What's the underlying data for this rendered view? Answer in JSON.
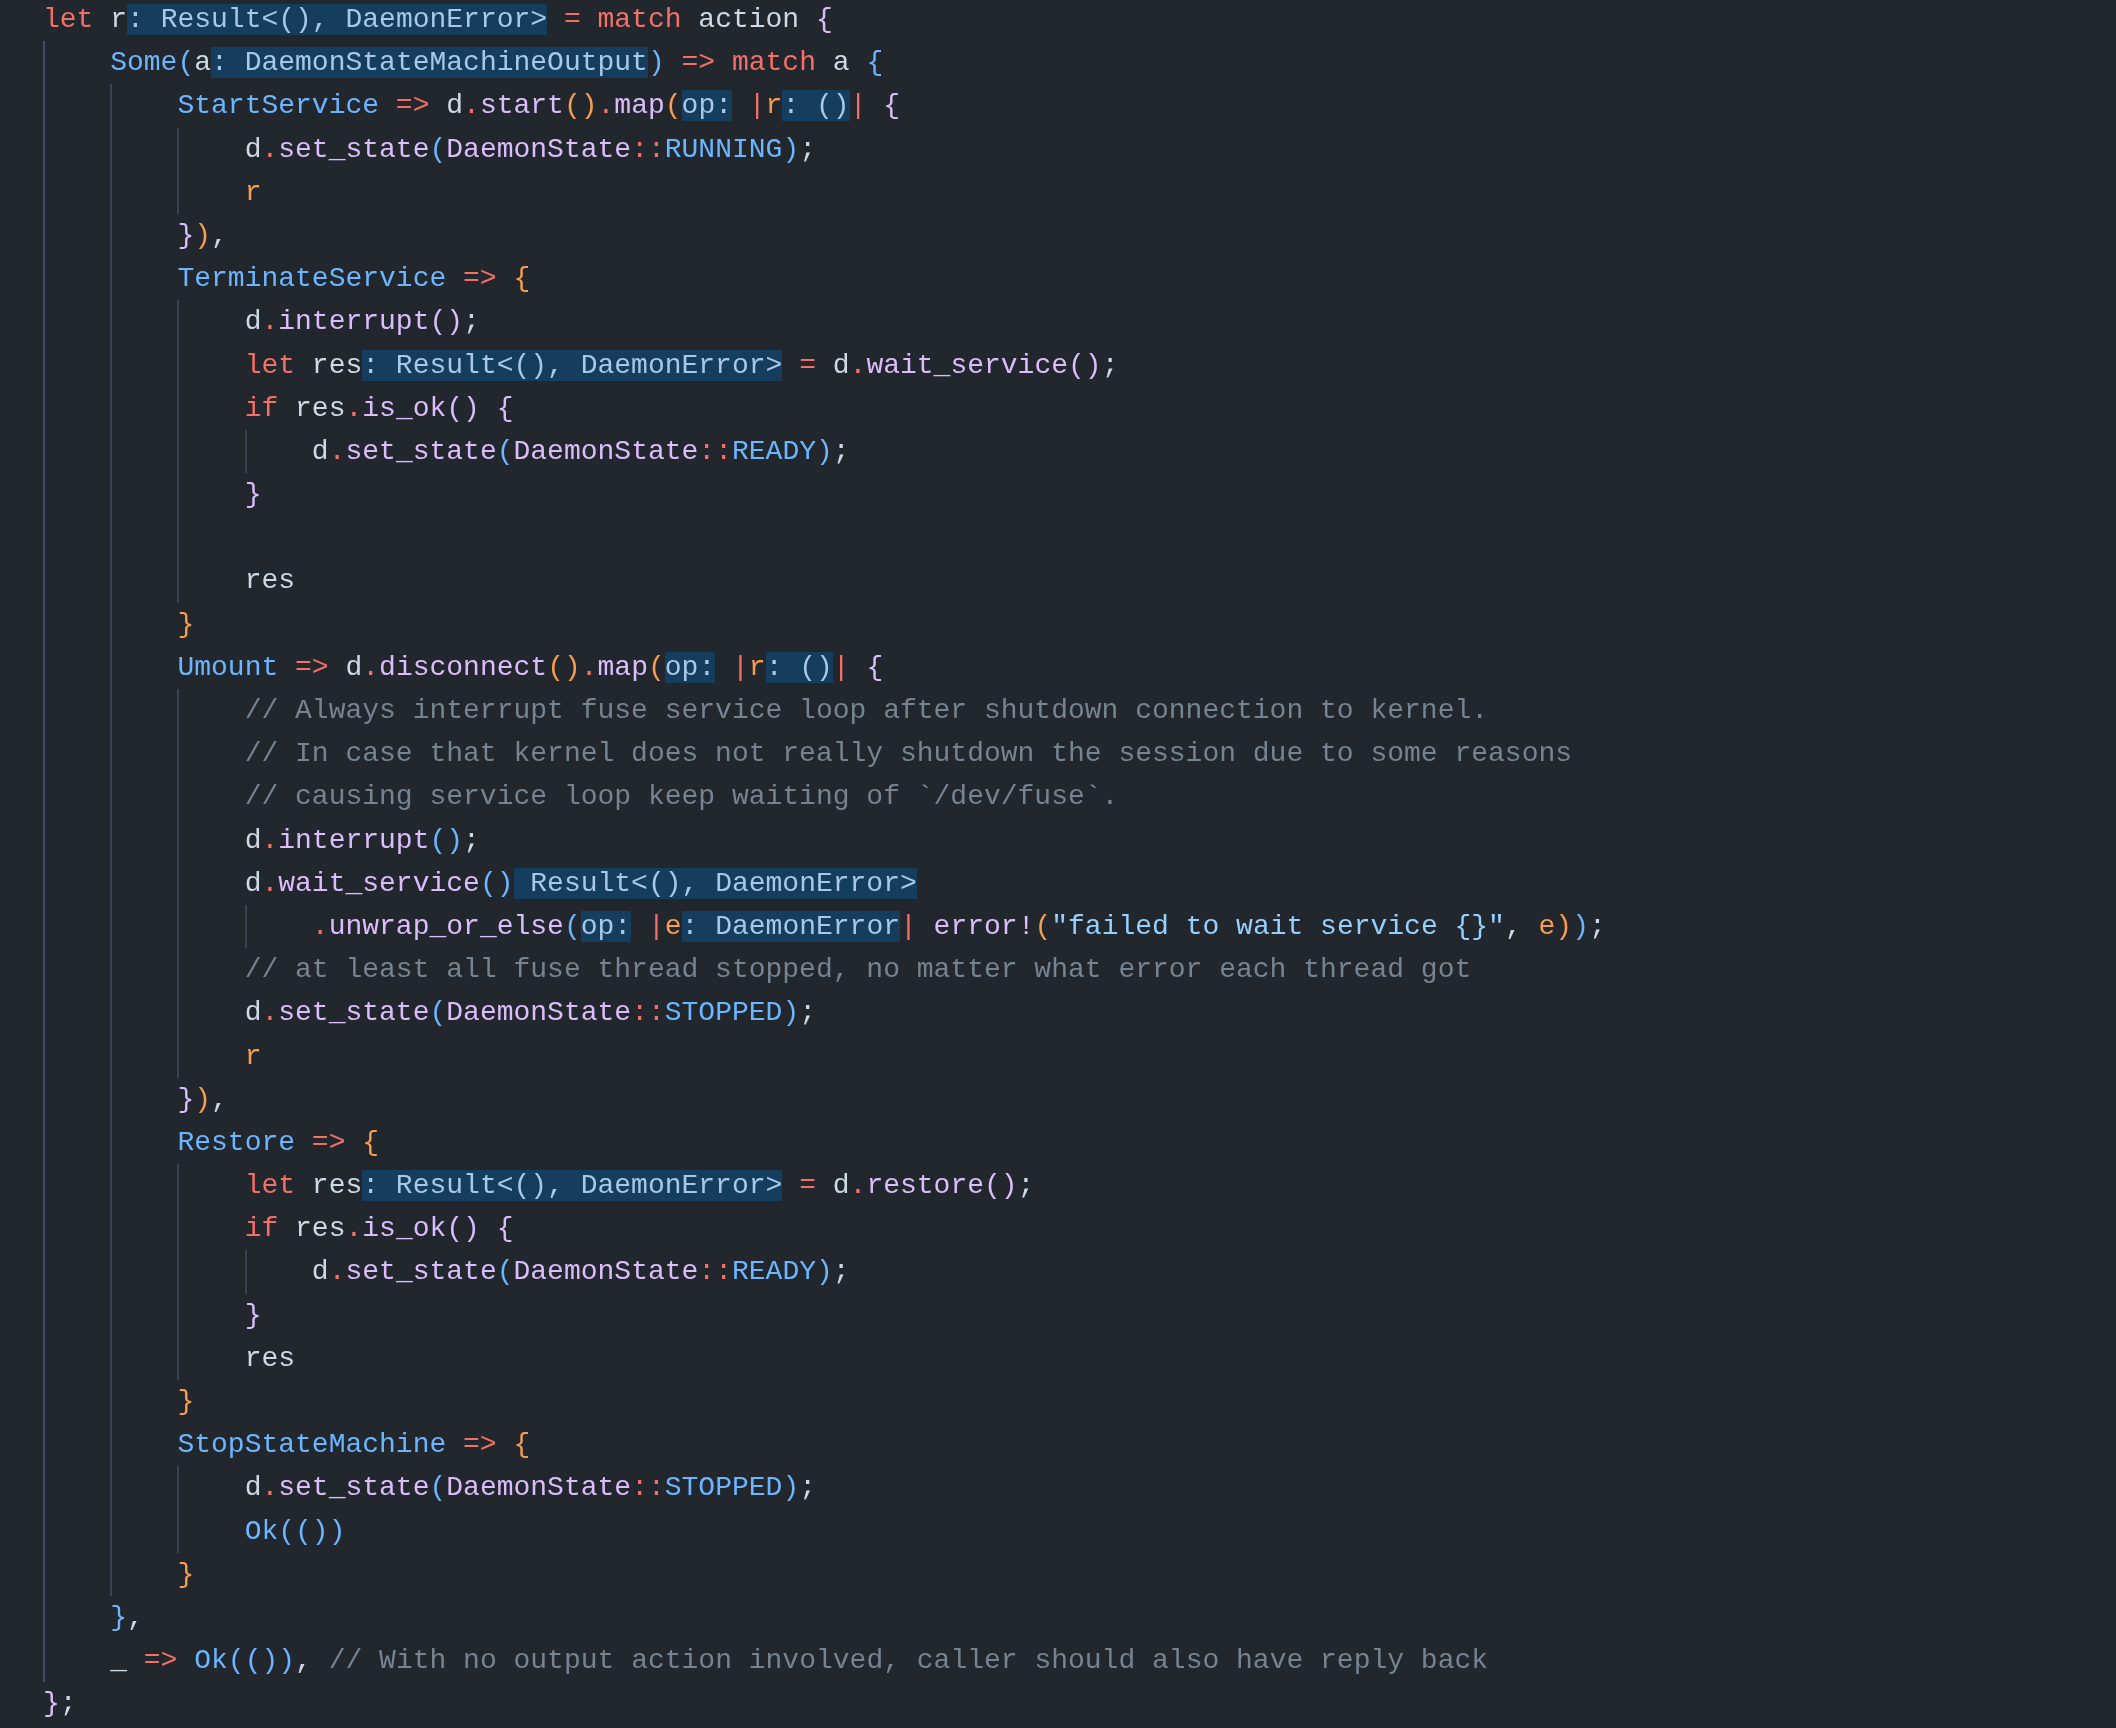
{
  "editor": {
    "lines": [
      {
        "kind": "code",
        "tokens": [
          {
            "kind": "kw",
            "text": "let"
          },
          {
            "kind": "plain",
            "text": " r"
          },
          {
            "kind": "hint",
            "text": ": Result<(), DaemonError>"
          },
          {
            "kind": "kw",
            "text": " = match"
          },
          {
            "kind": "plain",
            "text": " action "
          },
          {
            "kind": "purple",
            "text": "{"
          }
        ]
      },
      {
        "kind": "code",
        "tokens": [
          {
            "kind": "type",
            "text": "    Some"
          },
          {
            "kind": "blue",
            "text": "("
          },
          {
            "kind": "plain",
            "text": "a"
          },
          {
            "kind": "hint",
            "text": ": DaemonStateMachineOutput"
          },
          {
            "kind": "blue",
            "text": ")"
          },
          {
            "kind": "kw",
            "text": " => match"
          },
          {
            "kind": "plain",
            "text": " a "
          },
          {
            "kind": "blue",
            "text": "{"
          }
        ]
      },
      {
        "kind": "code",
        "tokens": [
          {
            "kind": "type",
            "text": "        StartService"
          },
          {
            "kind": "kw",
            "text": " =>"
          },
          {
            "kind": "plain",
            "text": " d"
          },
          {
            "kind": "kw",
            "text": "."
          },
          {
            "kind": "fn",
            "text": "start"
          },
          {
            "kind": "orange",
            "text": "()"
          },
          {
            "kind": "kw",
            "text": "."
          },
          {
            "kind": "fn",
            "text": "map"
          },
          {
            "kind": "orange",
            "text": "("
          },
          {
            "kind": "hint",
            "text": "op:"
          },
          {
            "kind": "kw",
            "text": " |"
          },
          {
            "kind": "var",
            "text": "r"
          },
          {
            "kind": "hint",
            "text": ": ()"
          },
          {
            "kind": "kw",
            "text": "|"
          },
          {
            "kind": "purple",
            "text": " {"
          }
        ]
      },
      {
        "kind": "code",
        "tokens": [
          {
            "kind": "plain",
            "text": "            d"
          },
          {
            "kind": "kw",
            "text": "."
          },
          {
            "kind": "fn",
            "text": "set_state"
          },
          {
            "kind": "blue",
            "text": "("
          },
          {
            "kind": "fn",
            "text": "DaemonState"
          },
          {
            "kind": "kw",
            "text": "::"
          },
          {
            "kind": "type",
            "text": "RUNNING"
          },
          {
            "kind": "blue",
            "text": ")"
          },
          {
            "kind": "plain",
            "text": ";"
          }
        ]
      },
      {
        "kind": "code",
        "tokens": [
          {
            "kind": "var",
            "text": "            r"
          }
        ]
      },
      {
        "kind": "code",
        "tokens": [
          {
            "kind": "purple",
            "text": "        }"
          },
          {
            "kind": "orange",
            "text": ")"
          },
          {
            "kind": "plain",
            "text": ","
          }
        ]
      },
      {
        "kind": "code",
        "tokens": [
          {
            "kind": "type",
            "text": "        TerminateService"
          },
          {
            "kind": "kw",
            "text": " =>"
          },
          {
            "kind": "orange",
            "text": " {"
          }
        ]
      },
      {
        "kind": "code",
        "tokens": [
          {
            "kind": "plain",
            "text": "            d"
          },
          {
            "kind": "kw",
            "text": "."
          },
          {
            "kind": "fn",
            "text": "interrupt"
          },
          {
            "kind": "purple",
            "text": "()"
          },
          {
            "kind": "plain",
            "text": ";"
          }
        ]
      },
      {
        "kind": "code",
        "tokens": [
          {
            "kind": "kw",
            "text": "            let"
          },
          {
            "kind": "plain",
            "text": " res"
          },
          {
            "kind": "hint",
            "text": ": Result<(), DaemonError>"
          },
          {
            "kind": "kw",
            "text": " ="
          },
          {
            "kind": "plain",
            "text": " d"
          },
          {
            "kind": "kw",
            "text": "."
          },
          {
            "kind": "fn",
            "text": "wait_service"
          },
          {
            "kind": "purple",
            "text": "()"
          },
          {
            "kind": "plain",
            "text": ";"
          }
        ]
      },
      {
        "kind": "code",
        "tokens": [
          {
            "kind": "kw",
            "text": "            if"
          },
          {
            "kind": "plain",
            "text": " res"
          },
          {
            "kind": "kw",
            "text": "."
          },
          {
            "kind": "fn",
            "text": "is_ok"
          },
          {
            "kind": "purple",
            "text": "()"
          },
          {
            "kind": "purple",
            "text": " {"
          }
        ]
      },
      {
        "kind": "code",
        "tokens": [
          {
            "kind": "plain",
            "text": "                d"
          },
          {
            "kind": "kw",
            "text": "."
          },
          {
            "kind": "fn",
            "text": "set_state"
          },
          {
            "kind": "blue",
            "text": "("
          },
          {
            "kind": "fn",
            "text": "DaemonState"
          },
          {
            "kind": "kw",
            "text": "::"
          },
          {
            "kind": "type",
            "text": "READY"
          },
          {
            "kind": "blue",
            "text": ")"
          },
          {
            "kind": "plain",
            "text": ";"
          }
        ]
      },
      {
        "kind": "code",
        "tokens": [
          {
            "kind": "purple",
            "text": "            }"
          }
        ]
      },
      {
        "kind": "blank"
      },
      {
        "kind": "code",
        "tokens": [
          {
            "kind": "plain",
            "text": "            res"
          }
        ]
      },
      {
        "kind": "code",
        "tokens": [
          {
            "kind": "orange",
            "text": "        }"
          }
        ]
      },
      {
        "kind": "code",
        "tokens": [
          {
            "kind": "type",
            "text": "        Umount"
          },
          {
            "kind": "kw",
            "text": " =>"
          },
          {
            "kind": "plain",
            "text": " d"
          },
          {
            "kind": "kw",
            "text": "."
          },
          {
            "kind": "fn",
            "text": "disconnect"
          },
          {
            "kind": "orange",
            "text": "()"
          },
          {
            "kind": "kw",
            "text": "."
          },
          {
            "kind": "fn",
            "text": "map"
          },
          {
            "kind": "orange",
            "text": "("
          },
          {
            "kind": "hint",
            "text": "op:"
          },
          {
            "kind": "kw",
            "text": " |"
          },
          {
            "kind": "var",
            "text": "r"
          },
          {
            "kind": "hint",
            "text": ": ()"
          },
          {
            "kind": "kw",
            "text": "|"
          },
          {
            "kind": "purple",
            "text": " {"
          }
        ]
      },
      {
        "kind": "comment",
        "tokens": [
          {
            "kind": "comment",
            "text": "            // Always interrupt fuse service loop after shutdown connection to kernel."
          }
        ]
      },
      {
        "kind": "comment",
        "tokens": [
          {
            "kind": "comment",
            "text": "            // In case that kernel does not really shutdown the session due to some reasons"
          }
        ]
      },
      {
        "kind": "comment",
        "tokens": [
          {
            "kind": "comment",
            "text": "            // causing service loop keep waiting of `/dev/fuse`."
          }
        ]
      },
      {
        "kind": "code",
        "tokens": [
          {
            "kind": "plain",
            "text": "            d"
          },
          {
            "kind": "kw",
            "text": "."
          },
          {
            "kind": "fn",
            "text": "interrupt"
          },
          {
            "kind": "blue",
            "text": "()"
          },
          {
            "kind": "plain",
            "text": ";"
          }
        ]
      },
      {
        "kind": "code",
        "tokens": [
          {
            "kind": "plain",
            "text": "            d"
          },
          {
            "kind": "kw",
            "text": "."
          },
          {
            "kind": "fn",
            "text": "wait_service"
          },
          {
            "kind": "blue",
            "text": "()"
          },
          {
            "kind": "hint",
            "text": " Result<(), DaemonError>"
          }
        ]
      },
      {
        "kind": "code",
        "tokens": [
          {
            "kind": "kw",
            "text": "                ."
          },
          {
            "kind": "fn",
            "text": "unwrap_or_else"
          },
          {
            "kind": "blue",
            "text": "("
          },
          {
            "kind": "hint",
            "text": "op:"
          },
          {
            "kind": "kw",
            "text": " |"
          },
          {
            "kind": "var",
            "text": "e"
          },
          {
            "kind": "hint",
            "text": ": DaemonError"
          },
          {
            "kind": "kw",
            "text": "|"
          },
          {
            "kind": "fn",
            "text": " error!"
          },
          {
            "kind": "orange",
            "text": "("
          },
          {
            "kind": "string",
            "text": "\"failed to wait service {}\""
          },
          {
            "kind": "plain",
            "text": ", "
          },
          {
            "kind": "var",
            "text": "e"
          },
          {
            "kind": "orange",
            "text": ")"
          },
          {
            "kind": "blue",
            "text": ")"
          },
          {
            "kind": "plain",
            "text": ";"
          }
        ]
      },
      {
        "kind": "comment",
        "tokens": [
          {
            "kind": "comment",
            "text": "            // at least all fuse thread stopped, no matter what error each thread got"
          }
        ]
      },
      {
        "kind": "code",
        "tokens": [
          {
            "kind": "plain",
            "text": "            d"
          },
          {
            "kind": "kw",
            "text": "."
          },
          {
            "kind": "fn",
            "text": "set_state"
          },
          {
            "kind": "blue",
            "text": "("
          },
          {
            "kind": "fn",
            "text": "DaemonState"
          },
          {
            "kind": "kw",
            "text": "::"
          },
          {
            "kind": "type",
            "text": "STOPPED"
          },
          {
            "kind": "blue",
            "text": ")"
          },
          {
            "kind": "plain",
            "text": ";"
          }
        ]
      },
      {
        "kind": "code",
        "tokens": [
          {
            "kind": "var",
            "text": "            r"
          }
        ]
      },
      {
        "kind": "code",
        "tokens": [
          {
            "kind": "purple",
            "text": "        }"
          },
          {
            "kind": "orange",
            "text": ")"
          },
          {
            "kind": "plain",
            "text": ","
          }
        ]
      },
      {
        "kind": "code",
        "tokens": [
          {
            "kind": "type",
            "text": "        Restore"
          },
          {
            "kind": "kw",
            "text": " =>"
          },
          {
            "kind": "orange",
            "text": " {"
          }
        ]
      },
      {
        "kind": "code",
        "tokens": [
          {
            "kind": "kw",
            "text": "            let"
          },
          {
            "kind": "plain",
            "text": " res"
          },
          {
            "kind": "hint",
            "text": ": Result<(), DaemonError>"
          },
          {
            "kind": "kw",
            "text": " ="
          },
          {
            "kind": "plain",
            "text": " d"
          },
          {
            "kind": "kw",
            "text": "."
          },
          {
            "kind": "fn",
            "text": "restore"
          },
          {
            "kind": "purple",
            "text": "()"
          },
          {
            "kind": "plain",
            "text": ";"
          }
        ]
      },
      {
        "kind": "code",
        "tokens": [
          {
            "kind": "kw",
            "text": "            if"
          },
          {
            "kind": "plain",
            "text": " res"
          },
          {
            "kind": "kw",
            "text": "."
          },
          {
            "kind": "fn",
            "text": "is_ok"
          },
          {
            "kind": "purple",
            "text": "()"
          },
          {
            "kind": "purple",
            "text": " {"
          }
        ]
      },
      {
        "kind": "code",
        "tokens": [
          {
            "kind": "plain",
            "text": "                d"
          },
          {
            "kind": "kw",
            "text": "."
          },
          {
            "kind": "fn",
            "text": "set_state"
          },
          {
            "kind": "blue",
            "text": "("
          },
          {
            "kind": "fn",
            "text": "DaemonState"
          },
          {
            "kind": "kw",
            "text": "::"
          },
          {
            "kind": "type",
            "text": "READY"
          },
          {
            "kind": "blue",
            "text": ")"
          },
          {
            "kind": "plain",
            "text": ";"
          }
        ]
      },
      {
        "kind": "code",
        "tokens": [
          {
            "kind": "purple",
            "text": "            }"
          }
        ]
      },
      {
        "kind": "code",
        "tokens": [
          {
            "kind": "plain",
            "text": "            res"
          }
        ]
      },
      {
        "kind": "code",
        "tokens": [
          {
            "kind": "orange",
            "text": "        }"
          }
        ]
      },
      {
        "kind": "code",
        "tokens": [
          {
            "kind": "type",
            "text": "        StopStateMachine"
          },
          {
            "kind": "kw",
            "text": " =>"
          },
          {
            "kind": "orange",
            "text": " {"
          }
        ]
      },
      {
        "kind": "code",
        "tokens": [
          {
            "kind": "plain",
            "text": "            d"
          },
          {
            "kind": "kw",
            "text": "."
          },
          {
            "kind": "fn",
            "text": "set_state"
          },
          {
            "kind": "blue",
            "text": "("
          },
          {
            "kind": "fn",
            "text": "DaemonState"
          },
          {
            "kind": "kw",
            "text": "::"
          },
          {
            "kind": "type",
            "text": "STOPPED"
          },
          {
            "kind": "blue",
            "text": ")"
          },
          {
            "kind": "plain",
            "text": ";"
          }
        ]
      },
      {
        "kind": "code",
        "tokens": [
          {
            "kind": "type",
            "text": "            Ok"
          },
          {
            "kind": "blue",
            "text": "(())"
          }
        ]
      },
      {
        "kind": "code",
        "tokens": [
          {
            "kind": "orange",
            "text": "        }"
          }
        ]
      },
      {
        "kind": "code",
        "tokens": [
          {
            "kind": "blue",
            "text": "    }"
          },
          {
            "kind": "plain",
            "text": ","
          }
        ]
      },
      {
        "kind": "code",
        "tokens": [
          {
            "kind": "plain",
            "text": "    _"
          },
          {
            "kind": "kw",
            "text": " =>"
          },
          {
            "kind": "type",
            "text": " Ok"
          },
          {
            "kind": "blue",
            "text": "(())"
          },
          {
            "kind": "plain",
            "text": ", "
          },
          {
            "kind": "comment",
            "text": "// With no output action involved, caller should also have reply back"
          }
        ]
      },
      {
        "kind": "code",
        "tokens": [
          {
            "kind": "purple",
            "text": "}"
          },
          {
            "kind": "plain",
            "text": ";"
          }
        ]
      }
    ]
  }
}
